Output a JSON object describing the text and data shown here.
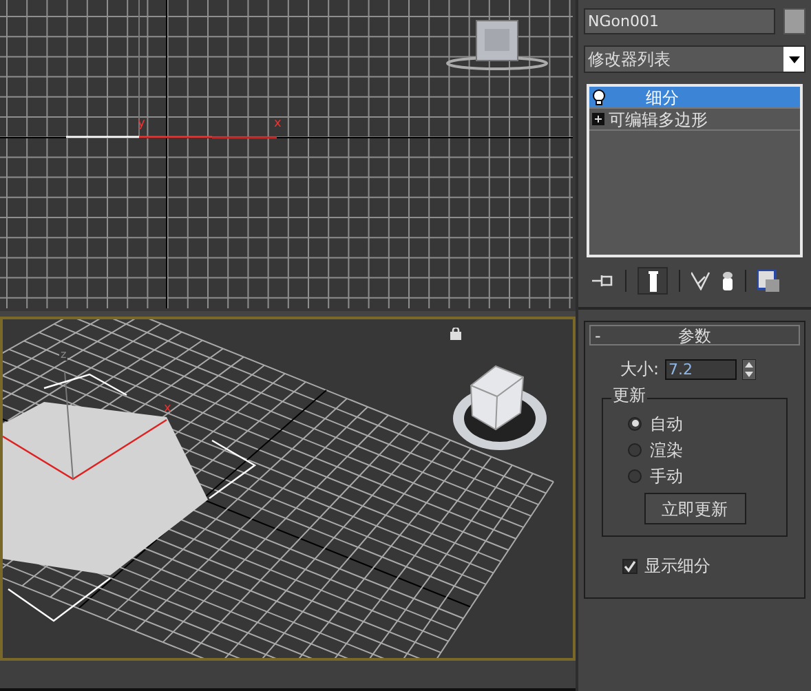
{
  "top_viewport": {
    "axis_labels": [
      "y",
      "x"
    ]
  },
  "perspective_viewport": {
    "active": true,
    "axis_labels": [
      "z",
      "x"
    ]
  },
  "object_name": {
    "value": "NGon001"
  },
  "modifier_list": {
    "value": "修改器列表"
  },
  "modifier_stack": [
    {
      "label": "细分",
      "kind": "modifier",
      "selected": true
    },
    {
      "label": "可编辑多边形",
      "kind": "base",
      "selected": false
    }
  ],
  "rollout": {
    "collapse_sign": "-",
    "title": "参数",
    "size_label": "大小:",
    "size_value": "7.2",
    "update_group": {
      "title": "更新",
      "options": [
        {
          "label": "自动",
          "selected": true
        },
        {
          "label": "渲染",
          "selected": false
        },
        {
          "label": "手动",
          "selected": false
        }
      ],
      "button": "立即更新"
    },
    "show_subdivision": {
      "label": "显示细分",
      "checked": true
    }
  }
}
